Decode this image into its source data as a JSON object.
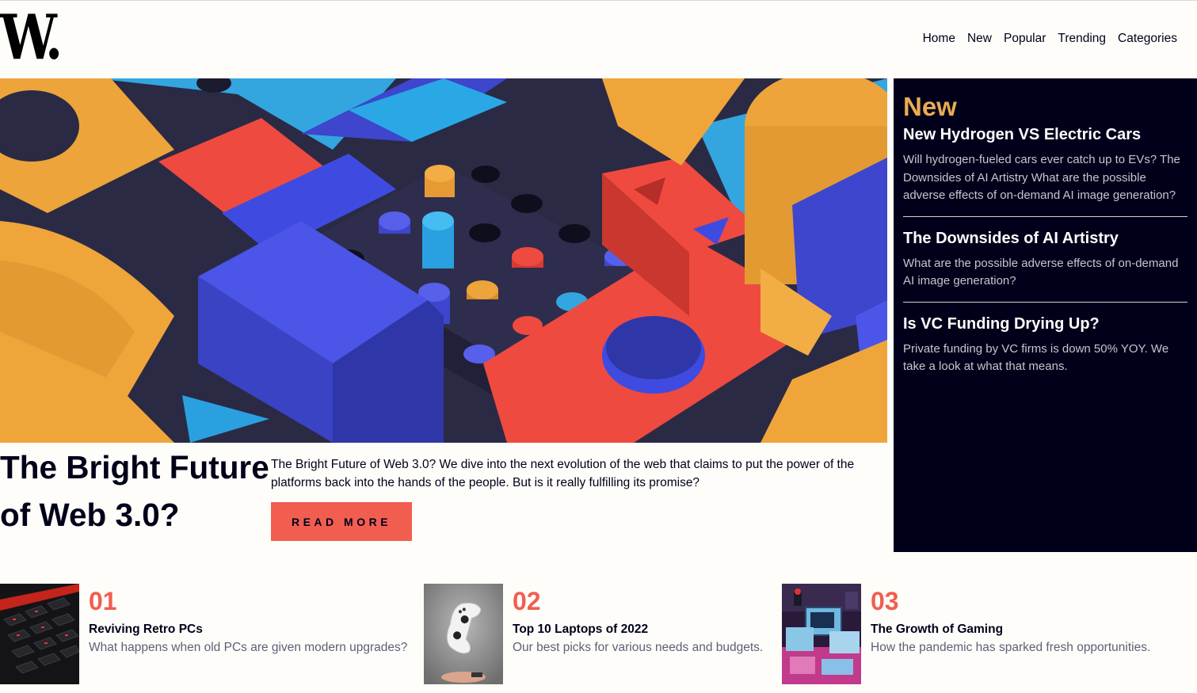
{
  "brand": {
    "logo_text": "W."
  },
  "nav": {
    "items": [
      "Home",
      "New",
      "Popular",
      "Trending",
      "Categories"
    ]
  },
  "hero": {
    "title": "The Bright Future of Web 3.0?",
    "description": "The Bright Future of Web 3.0? We dive into the next evolution of the web that claims to put the power of the platforms back into the hands of the people. But is it really fulfilling its promise?",
    "button_label": "READ MORE"
  },
  "new_panel": {
    "heading": "New",
    "items": [
      {
        "title": "New Hydrogen VS Electric Cars",
        "text": "Will hydrogen-fueled cars ever catch up to EVs? The Downsides of AI Artistry What are the possible adverse effects of on-demand AI image generation?"
      },
      {
        "title": "The Downsides of AI Artistry",
        "text": "What are the possible adverse effects of on-demand AI image generation?"
      },
      {
        "title": "Is VC Funding Drying Up?",
        "text": "Private funding by VC firms is down 50% YOY. We take a look at what that means."
      }
    ]
  },
  "cards": [
    {
      "number": "01",
      "title": "Reviving Retro PCs",
      "text": "What happens when old PCs are given modern upgrades?"
    },
    {
      "number": "02",
      "title": "Top 10 Laptops of 2022",
      "text": "Our best picks for various needs and budgets."
    },
    {
      "number": "03",
      "title": "The Growth of Gaming",
      "text": "How the pandemic has sparked fresh opportunities."
    }
  ],
  "colors": {
    "accent": "#f15e50",
    "dark": "#00001a",
    "gold": "#e9ab53",
    "muted": "#5d5f79",
    "background": "#fffdf9"
  }
}
